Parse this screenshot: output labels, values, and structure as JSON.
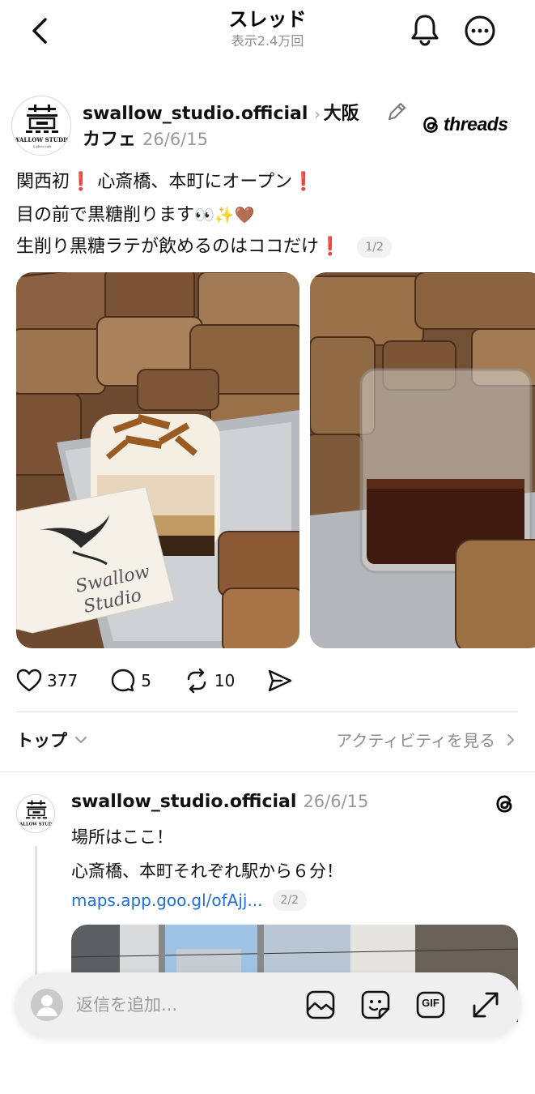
{
  "header": {
    "title": "スレッド",
    "subtitle": "表示2.4万回"
  },
  "post": {
    "username": "swallow_studio.official",
    "topic_part1": "大阪",
    "topic_part2": "カフェ",
    "date": "26/6/15",
    "brand": "threads",
    "avatar_logo_text": "WALLOW STUDIO",
    "lines": {
      "line1_a": "関西初",
      "line1_b": "心斎橋、本町にオープン",
      "line2_a": "目の前で黒糖削ります",
      "line3_a": "生削り黒糖ラテが飲めるのはココだけ",
      "exclaim": "❗",
      "emoji_eyes": "👀",
      "emoji_sparkles": "✨",
      "emoji_heart": "🤎"
    },
    "image_counter": "1/2",
    "card_text": "Swallow Studio",
    "actions": {
      "likes": "377",
      "replies": "5",
      "reposts": "10"
    }
  },
  "sort": {
    "label": "トップ",
    "activity_link": "アクティビティを見る"
  },
  "reply": {
    "username": "swallow_studio.official",
    "date": "26/6/15",
    "line1": "場所はここ！",
    "line2": "心斎橋、本町それぞれ駅から６分！",
    "link": "maps.app.goo.gl/ofAjj...",
    "counter": "2/2"
  },
  "composer": {
    "placeholder": "返信を追加...",
    "gif_label": "GIF"
  },
  "colors": {
    "link": "#1f6fd6",
    "muted": "#8e8e8e",
    "exclaim_red": "#e0112b",
    "composer_bg": "#efefef"
  },
  "icons": [
    "back-chevron-icon",
    "bell-icon",
    "more-icon",
    "pencil-icon",
    "threads-logo-icon",
    "heart-icon",
    "comment-icon",
    "repost-icon",
    "share-icon",
    "chevron-down-icon",
    "chevron-right-icon",
    "image-icon",
    "sticker-icon",
    "gif-icon",
    "expand-icon",
    "user-avatar-icon"
  ]
}
